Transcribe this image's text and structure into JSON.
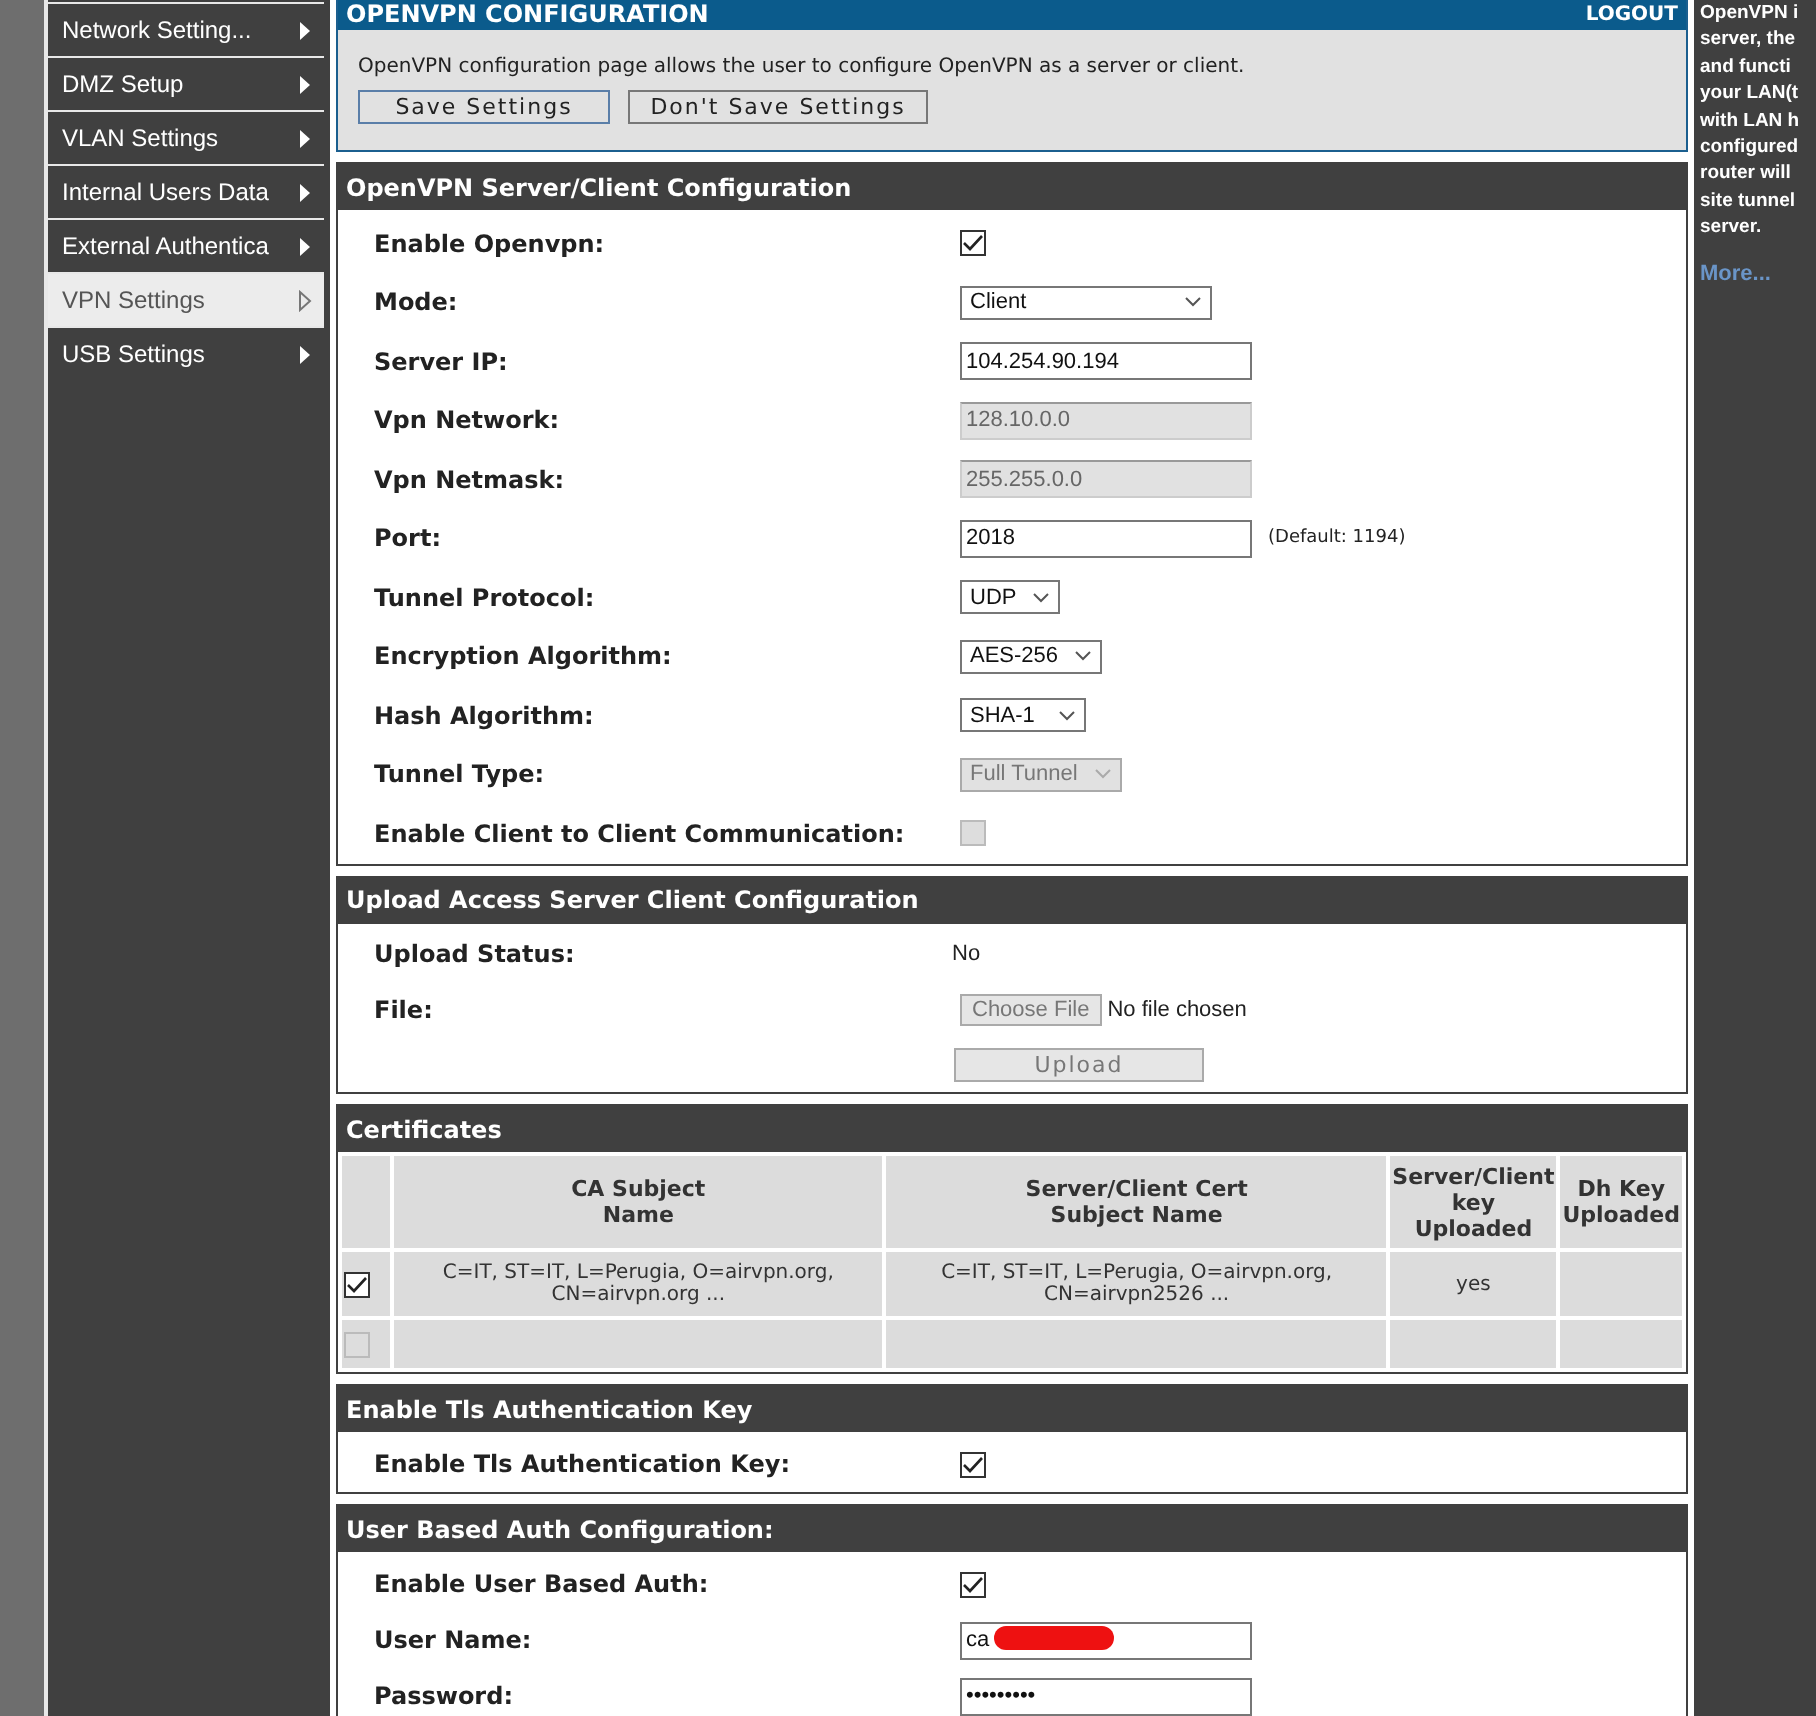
{
  "sidebar": {
    "items": [
      {
        "label": "Network Setting...",
        "selected": false
      },
      {
        "label": "DMZ Setup",
        "selected": false
      },
      {
        "label": "VLAN Settings",
        "selected": false
      },
      {
        "label": "Internal Users Data",
        "selected": false
      },
      {
        "label": "External Authentica",
        "selected": false
      },
      {
        "label": "VPN Settings",
        "selected": true
      },
      {
        "label": "USB Settings",
        "selected": false
      }
    ]
  },
  "header": {
    "title": "OPENVPN CONFIGURATION",
    "logout": "LOGOUT",
    "description": "OpenVPN configuration page allows the user to configure OpenVPN as a server or client.",
    "buttons": [
      "Save Settings",
      "Don't Save Settings"
    ]
  },
  "sections": [
    {
      "title": "OpenVPN Server/Client Configuration",
      "kind": "form",
      "rows": [
        {
          "label": "Enable Openvpn:",
          "kind": "checkbox",
          "checked": true,
          "disabled": false
        },
        {
          "label": "Mode:",
          "kind": "select",
          "value": "Client",
          "disabled": false
        },
        {
          "label": "Server IP:",
          "kind": "text",
          "value": "104.254.90.194",
          "disabled": false
        },
        {
          "label": "Vpn Network:",
          "kind": "text",
          "value": "128.10.0.0",
          "disabled": true
        },
        {
          "label": "Vpn Netmask:",
          "kind": "text",
          "value": "255.255.0.0",
          "disabled": true
        },
        {
          "label": "Port:",
          "kind": "text",
          "value": "2018",
          "disabled": false,
          "note": "(Default: 1194)"
        },
        {
          "label": "Tunnel Protocol:",
          "kind": "select",
          "value": "UDP",
          "disabled": false
        },
        {
          "label": "Encryption Algorithm:",
          "kind": "select",
          "value": "AES-256",
          "disabled": false
        },
        {
          "label": "Hash Algorithm:",
          "kind": "select",
          "value": "SHA-1",
          "disabled": false
        },
        {
          "label": "Tunnel Type:",
          "kind": "select",
          "value": "Full Tunnel",
          "disabled": true
        },
        {
          "label": "Enable Client to Client Communication:",
          "kind": "checkbox",
          "checked": false,
          "disabled": true
        }
      ]
    },
    {
      "title": "Upload Access Server Client Configuration",
      "kind": "form",
      "rows": [
        {
          "label": "Upload Status:",
          "kind": "static",
          "value": "No"
        },
        {
          "label": "File:",
          "kind": "file",
          "button": "Choose File",
          "value": "No file chosen"
        },
        {
          "kind": "button",
          "button": "Upload",
          "disabled": true
        }
      ]
    },
    {
      "title": "Certificates",
      "kind": "table",
      "columns": [
        "",
        "CA Subject\nName",
        "Server/Client Cert\nSubject Name",
        "Server/Client\nkey\nUploaded",
        "Dh Key\nUploaded"
      ],
      "rows": [
        {
          "checked": true,
          "disabled": false,
          "cells": [
            "",
            "C=IT, ST=IT, L=Perugia, O=airvpn.org,\nCN=airvpn.org ...",
            "C=IT, ST=IT, L=Perugia, O=airvpn.org,\nCN=airvpn2526 ...",
            "yes",
            ""
          ]
        },
        {
          "checked": false,
          "disabled": true,
          "cells": [
            "",
            "",
            "",
            "",
            ""
          ]
        }
      ]
    },
    {
      "title": "Enable Tls Authentication Key",
      "kind": "form",
      "rows": [
        {
          "label": "Enable Tls Authentication Key:",
          "kind": "checkbox",
          "checked": true,
          "disabled": false
        }
      ]
    },
    {
      "title": "User Based Auth Configuration:",
      "kind": "form",
      "rows": [
        {
          "label": "Enable User Based Auth:",
          "kind": "checkbox",
          "checked": true,
          "disabled": false
        },
        {
          "label": "User Name:",
          "kind": "text",
          "value": "ca",
          "disabled": false,
          "redacted": true
        },
        {
          "label": "Password:",
          "kind": "text",
          "value": "•••••••••",
          "disabled": false
        }
      ]
    }
  ],
  "help": {
    "lines": [
      "OpenVPN i",
      "server, the",
      "and functi",
      "your LAN(t",
      "with LAN h",
      "configured",
      "router will",
      "site tunnel",
      "server."
    ],
    "link": "More..."
  }
}
